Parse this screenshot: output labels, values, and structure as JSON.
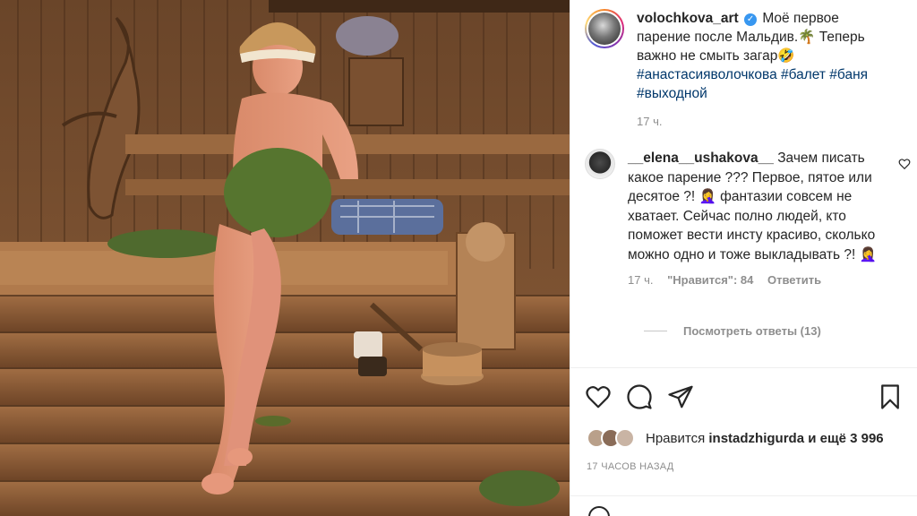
{
  "post": {
    "username": "volochkova_art",
    "verified_mark": "✓",
    "caption": "Моё первое парение после Мальдив.🌴 Теперь важно не смыть загар🤣",
    "hashtags": "#анастасияволочкова #балет #баня #выходной",
    "time": "17 ч."
  },
  "comment": {
    "username": "__elena__ushakova__",
    "text": "Зачем писать какое парение ??? Первое, пятое или десятое ?! 🤦‍♀️ фантазии совсем не хватает. Сейчас полно людей, кто поможет вести инсту красиво, сколько можно одно и тоже выкладывать ?! 🤦‍♀️",
    "time": "17 ч.",
    "likes": "\"Нравится\": 84",
    "reply": "Ответить",
    "view_replies": "Посмотреть ответы (13)"
  },
  "actions": {
    "like_icon": "heart-icon",
    "comment_icon": "comment-icon",
    "share_icon": "share-icon",
    "save_icon": "bookmark-icon"
  },
  "likes": {
    "prefix": "Нравится",
    "user": "instadzhigurda",
    "suffix": "и ещё 3 996"
  },
  "timestamp": "17 ЧАСОВ НАЗАД",
  "colors": {
    "link": "#00376b",
    "muted": "#8e8e8e",
    "verified": "#3897f0",
    "text": "#262626"
  }
}
